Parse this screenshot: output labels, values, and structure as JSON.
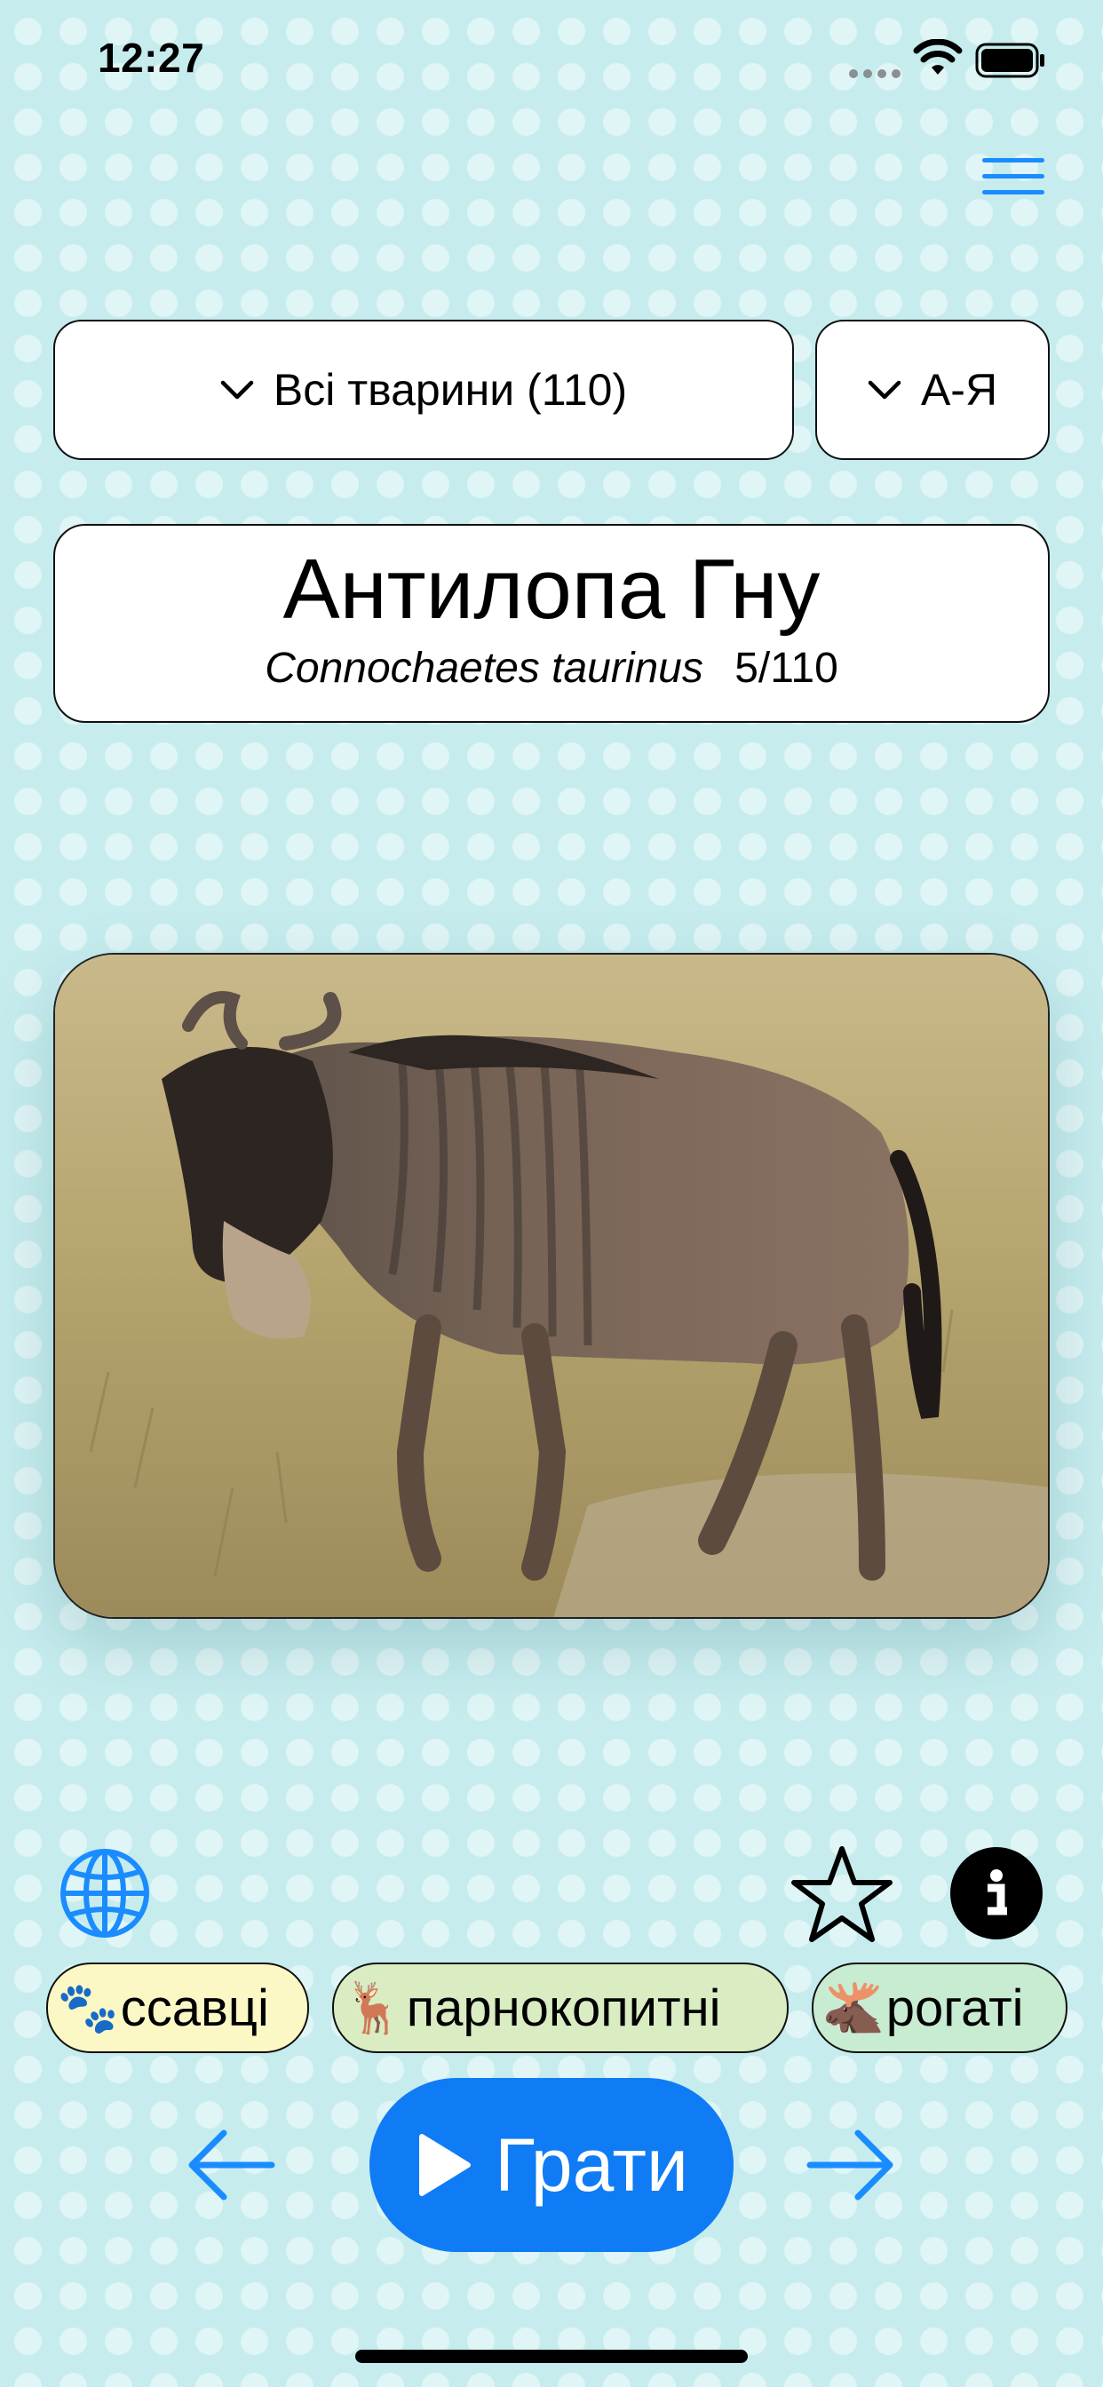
{
  "status_bar": {
    "time": "12:27"
  },
  "filters": {
    "group_label": "Всі тварини (110)",
    "sort_label": "А-Я"
  },
  "animal": {
    "name": "Антилопа Гну",
    "latin_name": "Connochaetes taurinus",
    "position": "5/110"
  },
  "tags": [
    {
      "emoji": "🐾",
      "label": "ссавці"
    },
    {
      "emoji": "🦌",
      "label": "парнокопитні"
    },
    {
      "emoji": "🫎",
      "label": "рогаті"
    }
  ],
  "controls": {
    "play_label": "Грати"
  },
  "icons": {
    "menu": "hamburger-icon",
    "globe": "globe-icon",
    "favorite": "star-outline-icon",
    "info": "info-icon",
    "prev": "arrow-left-icon",
    "next": "arrow-right-icon",
    "play": "play-triangle-icon"
  },
  "colors": {
    "background": "#c6ecee",
    "accent_blue": "#0f7cf5",
    "tag_mammals": "#fbf8c6",
    "tag_artiodactyls": "#d9ecc2",
    "tag_horned": "#c8ecd2"
  }
}
